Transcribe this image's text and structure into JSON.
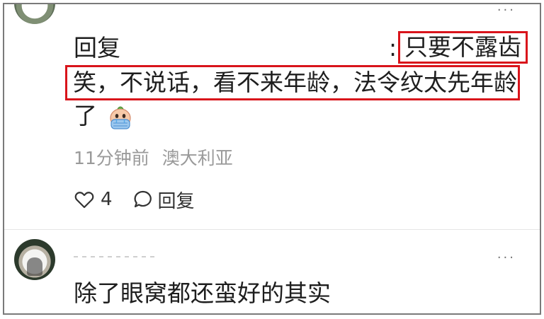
{
  "comment1": {
    "reply_word": "回复",
    "colon": ":",
    "highlight_start": "只要不露齿",
    "highlight_line": "笑，不说话，看不来年龄，法令纹太先年龄",
    "tail": "了",
    "emoji": "crying-baby-emoji",
    "time": "11分钟前",
    "location": "澳大利亚",
    "like_count": "4",
    "reply_label": "回复",
    "more": "···"
  },
  "comment2": {
    "text": "除了眼窝都还蛮好的其实",
    "more": "···"
  },
  "colors": {
    "highlight_border": "#d9141b",
    "meta_text": "#9a9a9a"
  },
  "icons": [
    "heart-icon",
    "comment-bubble-icon",
    "more-dots-icon"
  ]
}
